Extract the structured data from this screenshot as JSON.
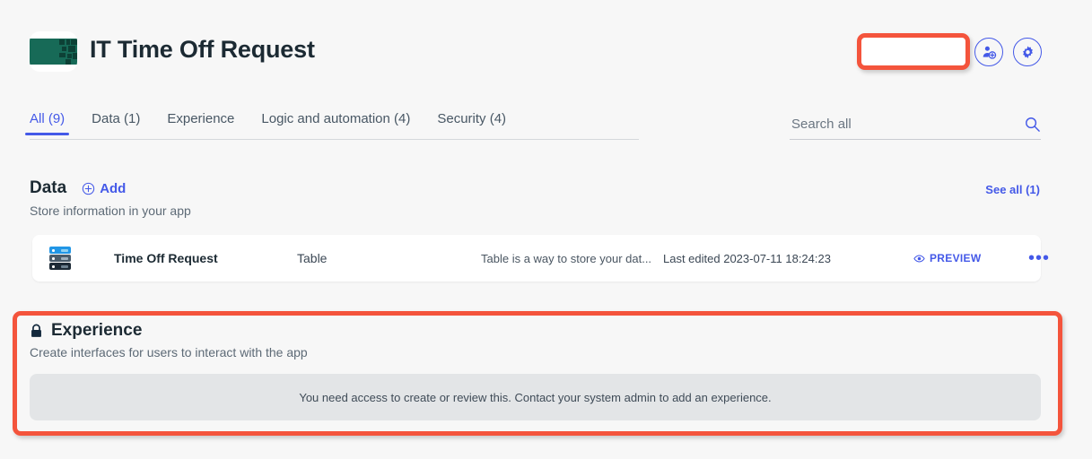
{
  "header": {
    "title": "IT Time Off Request",
    "app_icon_name": "app-icon",
    "buttons": [
      {
        "name": "share-users-button",
        "icon": "person-add-icon"
      },
      {
        "name": "settings-button",
        "icon": "gear-icon"
      }
    ]
  },
  "tabs": [
    {
      "label": "All (9)",
      "active": true
    },
    {
      "label": "Data (1)",
      "active": false
    },
    {
      "label": "Experience",
      "active": false
    },
    {
      "label": "Logic and automation (4)",
      "active": false
    },
    {
      "label": "Security (4)",
      "active": false
    }
  ],
  "search": {
    "placeholder": "Search all",
    "value": "",
    "icon": "search-icon"
  },
  "data_section": {
    "title": "Data",
    "add_label": "Add",
    "subtitle": "Store information in your app",
    "see_all": "See all (1)",
    "rows": [
      {
        "icon": "table-database-icon",
        "name": "Time Off Request",
        "type": "Table",
        "description": "Table is a way to store your dat...",
        "last_edited": "Last edited 2023-07-11 18:24:23",
        "preview_label": "PREVIEW",
        "more_label": "•••"
      }
    ]
  },
  "experience_section": {
    "lock_icon": "lock-icon",
    "title": "Experience",
    "subtitle": "Create interfaces for users to interact with the app",
    "empty_message": "You need access to create or review this. Contact your system admin to add an experience."
  },
  "colors": {
    "accent": "#4459e8",
    "annotation": "#f4543c",
    "app_icon": "#176a57",
    "page_bg": "#f7f7f7",
    "heading": "#1c2a33"
  }
}
